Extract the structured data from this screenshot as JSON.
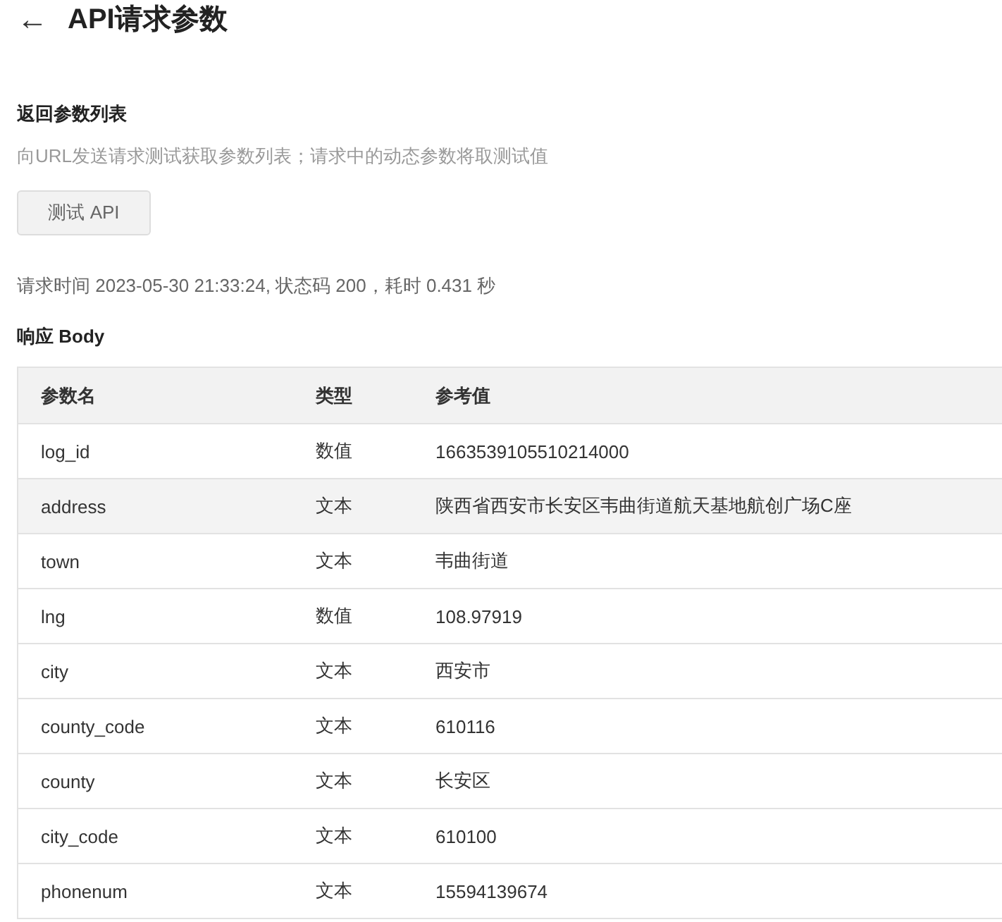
{
  "header": {
    "back": "←",
    "title": "API请求参数"
  },
  "section": {
    "title": "返回参数列表",
    "description": "向URL发送请求测试获取参数列表；请求中的动态参数将取测试值",
    "button": "测试 API"
  },
  "status": "请求时间 2023-05-30 21:33:24, 状态码 200，耗时 0.431 秒",
  "response_title": "响应 Body",
  "table": {
    "columns": [
      "参数名",
      "类型",
      "参考值"
    ],
    "rows": [
      {
        "cells": [
          "log_id",
          "数值",
          "1663539105510214000"
        ],
        "highlighted": false
      },
      {
        "cells": [
          "address",
          "文本",
          "陕西省西安市长安区韦曲街道航天基地航创广场C座"
        ],
        "highlighted": true
      },
      {
        "cells": [
          "town",
          "文本",
          "韦曲街道"
        ],
        "highlighted": false
      },
      {
        "cells": [
          "lng",
          "数值",
          "108.97919"
        ],
        "highlighted": false
      },
      {
        "cells": [
          "city",
          "文本",
          "西安市"
        ],
        "highlighted": false
      },
      {
        "cells": [
          "county_code",
          "文本",
          "610116"
        ],
        "highlighted": false
      },
      {
        "cells": [
          "county",
          "文本",
          "长安区"
        ],
        "highlighted": false
      },
      {
        "cells": [
          "city_code",
          "文本",
          "610100"
        ],
        "highlighted": false
      },
      {
        "cells": [
          "phonenum",
          "文本",
          "15594139674"
        ],
        "highlighted": false
      }
    ]
  }
}
